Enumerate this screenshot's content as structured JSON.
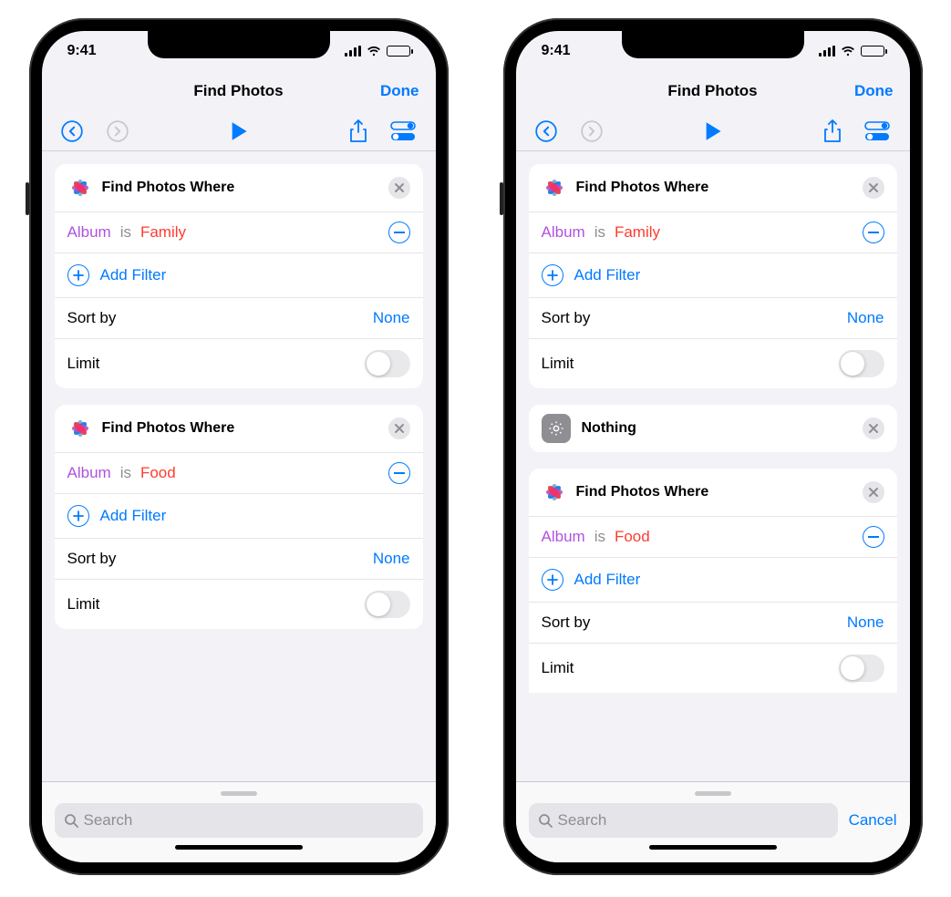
{
  "status": {
    "time": "9:41"
  },
  "nav": {
    "title": "Find Photos",
    "done": "Done"
  },
  "labels": {
    "add_filter": "Add Filter",
    "sort_by": "Sort by",
    "limit": "Limit",
    "none": "None",
    "filter_field": "Album",
    "filter_op": "is"
  },
  "phone_left": {
    "cards": [
      {
        "title": "Find Photos Where",
        "filter_value": "Family"
      },
      {
        "title": "Find Photos Where",
        "filter_value": "Food"
      }
    ],
    "search_placeholder": "Search"
  },
  "phone_right": {
    "cards": [
      {
        "title": "Find Photos Where",
        "filter_value": "Family"
      },
      {
        "title": "Find Photos Where",
        "filter_value": "Food"
      }
    ],
    "nothing_label": "Nothing",
    "search_placeholder": "Search",
    "cancel": "Cancel"
  }
}
